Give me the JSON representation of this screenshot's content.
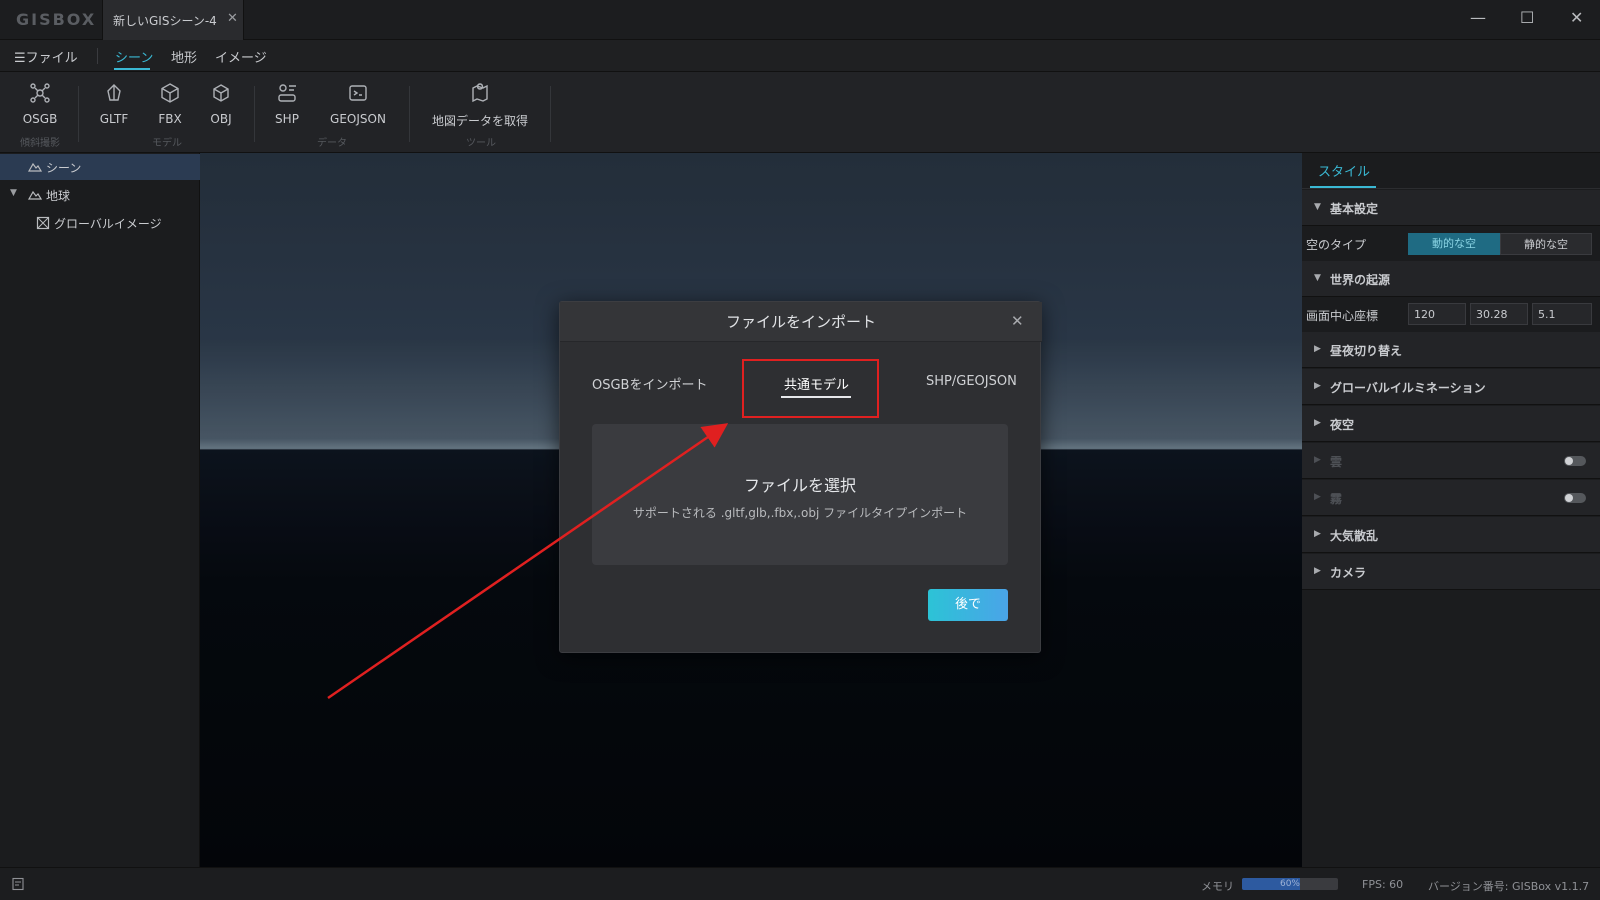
{
  "app": {
    "logo": "GISBOX",
    "tab_title": "新しいGISシーン-4",
    "tab_close": "✕"
  },
  "window_controls": {
    "minimize": "—",
    "maximize": "☐",
    "close": "✕"
  },
  "menu": {
    "file": "☰ファイル",
    "scene": "シーン",
    "terrain": "地形",
    "image": "イメージ"
  },
  "toolbar": {
    "osgb": "OSGB",
    "gltf": "GLTF",
    "fbx": "FBX",
    "obj": "OBJ",
    "shp": "SHP",
    "geojson": "GEOJSON",
    "map_data": "地図データを取得",
    "group_oblique": "傾斜撮影",
    "group_model": "モデル",
    "group_data": "データ",
    "group_tool": "ツール"
  },
  "tree": {
    "scene": "シーン",
    "earth": "地球",
    "global_image": "グローバルイメージ"
  },
  "right_panel": {
    "tab_style": "スタイル",
    "basic_settings": "基本設定",
    "sky_type_label": "空のタイプ",
    "sky_dynamic": "動的な空",
    "sky_static": "静的な空",
    "world_origin": "世界の起源",
    "screen_center_label": "画面中心座標",
    "coord_x": "120",
    "coord_y": "30.28",
    "coord_z": "5.1",
    "day_night": "昼夜切り替え",
    "global_illumination": "グローバルイルミネーション",
    "night_sky": "夜空",
    "cloud": "雲",
    "fog": "霧",
    "atmosphere": "大気散乱",
    "camera": "カメラ"
  },
  "dialog": {
    "title": "ファイルをインポート",
    "close": "✕",
    "tab_osgb": "OSGBをインポート",
    "tab_common_model": "共通モデル",
    "tab_shp": "SHP/GEOJSON",
    "select_file": "ファイルを選択",
    "supported": "サポートされる .gltf,glb,.fbx,.obj ファイルタイプインポート",
    "later": "後で"
  },
  "status": {
    "memory_label": "メモリ",
    "memory_percent": "60%",
    "memory_fraction": 0.6,
    "fps": "FPS: 60",
    "version": "バージョン番号: GISBox v1.1.7"
  },
  "colors": {
    "accent": "#3ab8d3",
    "selected_row": "#2b3b52",
    "annotation_red": "#e02020",
    "button_gradient_start": "#2cc3d6",
    "button_gradient_end": "#4aa4e8"
  }
}
